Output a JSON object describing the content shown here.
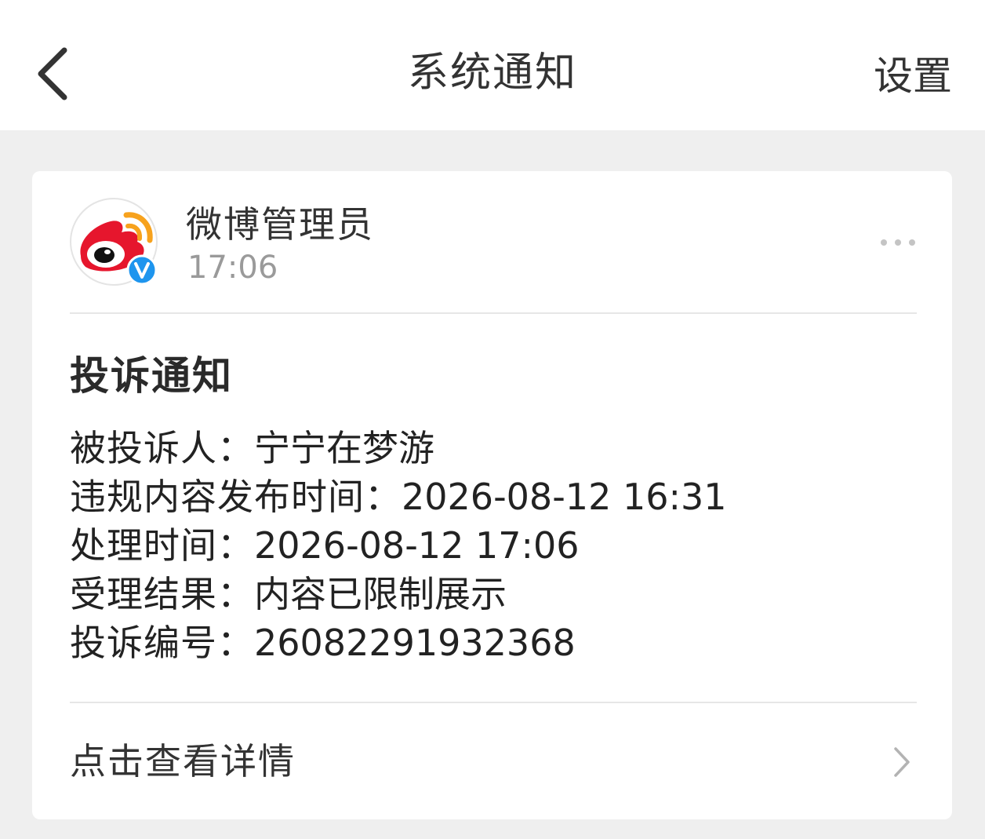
{
  "header": {
    "title": "系统通知",
    "settings_label": "设置"
  },
  "message": {
    "sender_name": "微博管理员",
    "time": "17:06",
    "heading": "投诉通知",
    "details": [
      {
        "label": "被投诉人：",
        "value": "宁宁在梦游"
      },
      {
        "label": "违规内容发布时间：",
        "value": "2026-08-12 16:31"
      },
      {
        "label": "处理时间：",
        "value": "2026-08-12 17:06"
      },
      {
        "label": "受理结果：",
        "value": "内容已限制展示"
      },
      {
        "label": "投诉编号：",
        "value": "26082291932368"
      }
    ],
    "view_details_label": "点击查看详情"
  },
  "colors": {
    "weibo_red": "#e6162d",
    "weibo_orange": "#f7a21d",
    "verified_blue": "#1e95ee"
  }
}
